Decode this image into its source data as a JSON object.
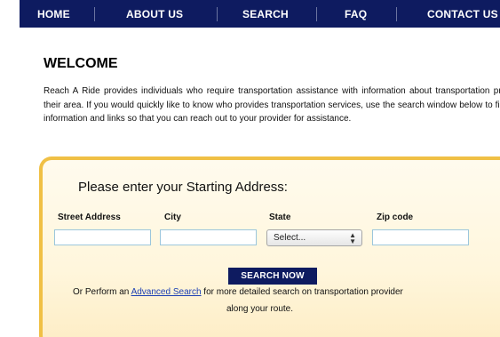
{
  "nav": {
    "items": [
      {
        "label": "HOME"
      },
      {
        "label": "ABOUT US"
      },
      {
        "label": "SEARCH"
      },
      {
        "label": "FAQ"
      },
      {
        "label": "CONTACT US"
      }
    ]
  },
  "welcome": {
    "title": "WELCOME",
    "paragraph": "Reach A Ride provides individuals who require transportation assistance with information about transportation providers in their area. If you would quickly like to know who provides transportation services, use the search window below to find contact information and links so that you can reach out to your provider for assistance."
  },
  "search_form": {
    "heading": "Please enter your Starting Address:",
    "labels": {
      "street": "Street Address",
      "city": "City",
      "state": "State",
      "zip": "Zip code"
    },
    "values": {
      "street": "",
      "city": "",
      "zip": ""
    },
    "state_select": "Select...",
    "submit_label": "SEARCH NOW",
    "advanced": {
      "prefix": "Or Perform an ",
      "link_text": "Advanced Search",
      "suffix": " for more detailed search on transportation provider",
      "line2": "along your route."
    }
  },
  "colors": {
    "nav_background": "#0e1b60",
    "box_border": "#f0c045",
    "link": "#1c3fb4"
  }
}
